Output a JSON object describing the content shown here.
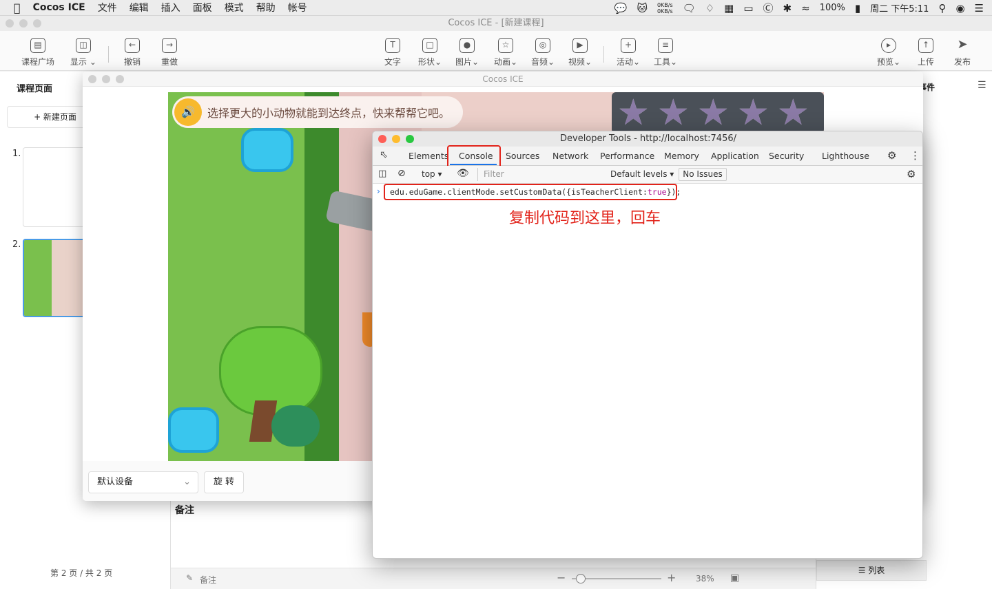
{
  "menubar": {
    "app_name": "Cocos ICE",
    "items": [
      "文件",
      "编辑",
      "插入",
      "面板",
      "模式",
      "帮助",
      "帐号"
    ],
    "net_up": "0KB/s",
    "net_down": "0KB/s",
    "battery": "100%",
    "clock": "周二 下午5:11"
  },
  "editor": {
    "window_title": "Cocos ICE - [新建课程]",
    "toolbar_left": [
      {
        "label": "课程广场",
        "icon": "book-icon"
      },
      {
        "label": "显示",
        "icon": "layout-icon"
      },
      {
        "label": "撤销",
        "icon": "undo-icon"
      },
      {
        "label": "重做",
        "icon": "redo-icon"
      }
    ],
    "toolbar_center": [
      {
        "label": "文字",
        "icon": "text-icon"
      },
      {
        "label": "形状",
        "icon": "shape-icon"
      },
      {
        "label": "图片",
        "icon": "image-icon"
      },
      {
        "label": "动画",
        "icon": "animation-icon"
      },
      {
        "label": "音频",
        "icon": "microphone-icon"
      },
      {
        "label": "视频",
        "icon": "video-icon"
      },
      {
        "label": "活动",
        "icon": "gamepad-icon"
      },
      {
        "label": "工具",
        "icon": "tools-icon"
      }
    ],
    "toolbar_right": [
      {
        "label": "预览",
        "icon": "play-icon"
      },
      {
        "label": "上传",
        "icon": "upload-icon"
      },
      {
        "label": "发布",
        "icon": "send-icon"
      }
    ],
    "left_tab": "课程页面",
    "new_page_label": "+ 新建页面",
    "slides": [
      "1.",
      "2."
    ],
    "page_count": "第 2 页 / 共 2 页",
    "right_tab": "互事件",
    "notes_label": "备注",
    "bottom_notes": "备注",
    "zoom": "38%",
    "list_label": "列表"
  },
  "preview": {
    "title": "Cocos ICE",
    "prompt_text": "选择更大的小动物就能到达终点，快来帮帮它吧。",
    "stars": 5,
    "device_select": "默认设备",
    "rotate_label": "旋 转"
  },
  "devtools": {
    "title": "Developer Tools - http://localhost:7456/",
    "tabs": [
      "Elements",
      "Console",
      "Sources",
      "Network",
      "Performance",
      "Memory",
      "Application",
      "Security",
      "Lighthouse"
    ],
    "active_tab": "Console",
    "context": "top",
    "filter_placeholder": "Filter",
    "levels": "Default levels",
    "issues": "No Issues",
    "command_prefix": "edu.eduGame.clientMode.setCustomData({isTeacherClient:",
    "command_keyword": "true",
    "command_suffix": "});",
    "annotation": "复制代码到这里，回车",
    "accent_color": "#e2231a"
  }
}
